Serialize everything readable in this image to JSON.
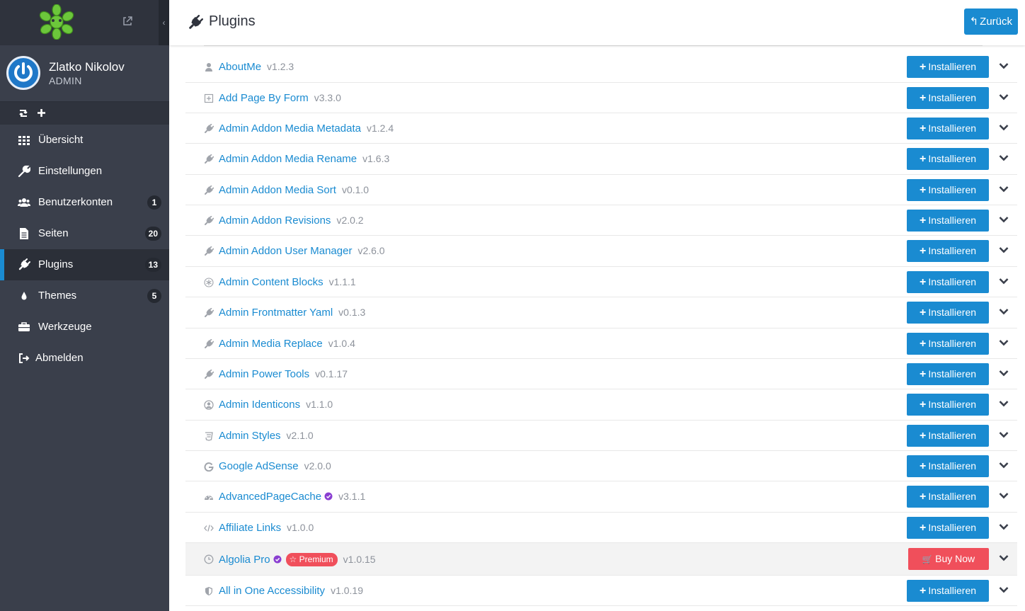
{
  "sidebar": {
    "user": {
      "name": "Zlatko Nikolov",
      "role": "ADMIN"
    },
    "nav": [
      {
        "label": "Übersicht",
        "icon": "grid-icon",
        "badge": null,
        "active": false
      },
      {
        "label": "Einstellungen",
        "icon": "wrench-icon",
        "badge": null,
        "active": false
      },
      {
        "label": "Benutzerkonten",
        "icon": "users-icon",
        "badge": "1",
        "active": false
      },
      {
        "label": "Seiten",
        "icon": "file-icon",
        "badge": "20",
        "active": false
      },
      {
        "label": "Plugins",
        "icon": "plug-icon",
        "badge": "13",
        "active": true
      },
      {
        "label": "Themes",
        "icon": "tint-icon",
        "badge": "5",
        "active": false
      },
      {
        "label": "Werkzeuge",
        "icon": "briefcase-icon",
        "badge": null,
        "active": false
      },
      {
        "label": "Abmelden",
        "icon": "sign-out-icon",
        "badge": null,
        "active": false
      }
    ]
  },
  "header": {
    "title": "Plugins",
    "back_label": "Zurück"
  },
  "colors": {
    "accent": "#1a8bd1",
    "premium": "#f04f5b",
    "sidebar": "#3a3f4b",
    "logo": "#6cc73b"
  },
  "plugins": [
    {
      "name": "AboutMe",
      "version": "v1.2.3",
      "icon": "user-icon"
    },
    {
      "name": "Add Page By Form",
      "version": "v3.3.0",
      "icon": "plus-square-icon"
    },
    {
      "name": "Admin Addon Media Metadata",
      "version": "v1.2.4",
      "icon": "plug-icon"
    },
    {
      "name": "Admin Addon Media Rename",
      "version": "v1.6.3",
      "icon": "plug-icon"
    },
    {
      "name": "Admin Addon Media Sort",
      "version": "v0.1.0",
      "icon": "plug-icon"
    },
    {
      "name": "Admin Addon Revisions",
      "version": "v2.0.2",
      "icon": "plug-icon"
    },
    {
      "name": "Admin Addon User Manager",
      "version": "v2.6.0",
      "icon": "plug-icon"
    },
    {
      "name": "Admin Content Blocks",
      "version": "v1.1.1",
      "icon": "snowflake-icon"
    },
    {
      "name": "Admin Frontmatter Yaml",
      "version": "v0.1.3",
      "icon": "plug-icon"
    },
    {
      "name": "Admin Media Replace",
      "version": "v1.0.4",
      "icon": "plug-icon"
    },
    {
      "name": "Admin Power Tools",
      "version": "v0.1.17",
      "icon": "plug-icon"
    },
    {
      "name": "Admin Identicons",
      "version": "v1.1.0",
      "icon": "user-circle-icon"
    },
    {
      "name": "Admin Styles",
      "version": "v2.1.0",
      "icon": "css3-icon"
    },
    {
      "name": "Google AdSense",
      "version": "v2.0.0",
      "icon": "google-icon"
    },
    {
      "name": "AdvancedPageCache",
      "version": "v3.1.1",
      "icon": "tachometer-icon",
      "verified": true
    },
    {
      "name": "Affiliate Links",
      "version": "v1.0.0",
      "icon": "code-icon"
    },
    {
      "name": "Algolia Pro",
      "version": "v1.0.15",
      "icon": "clock-icon",
      "verified": true,
      "premium": true,
      "premium_label": "Premium"
    },
    {
      "name": "All in One Accessibility",
      "version": "v1.0.19",
      "icon": "shield-icon"
    }
  ],
  "actions": {
    "install_label": "Installieren",
    "buy_label": "Buy Now"
  }
}
